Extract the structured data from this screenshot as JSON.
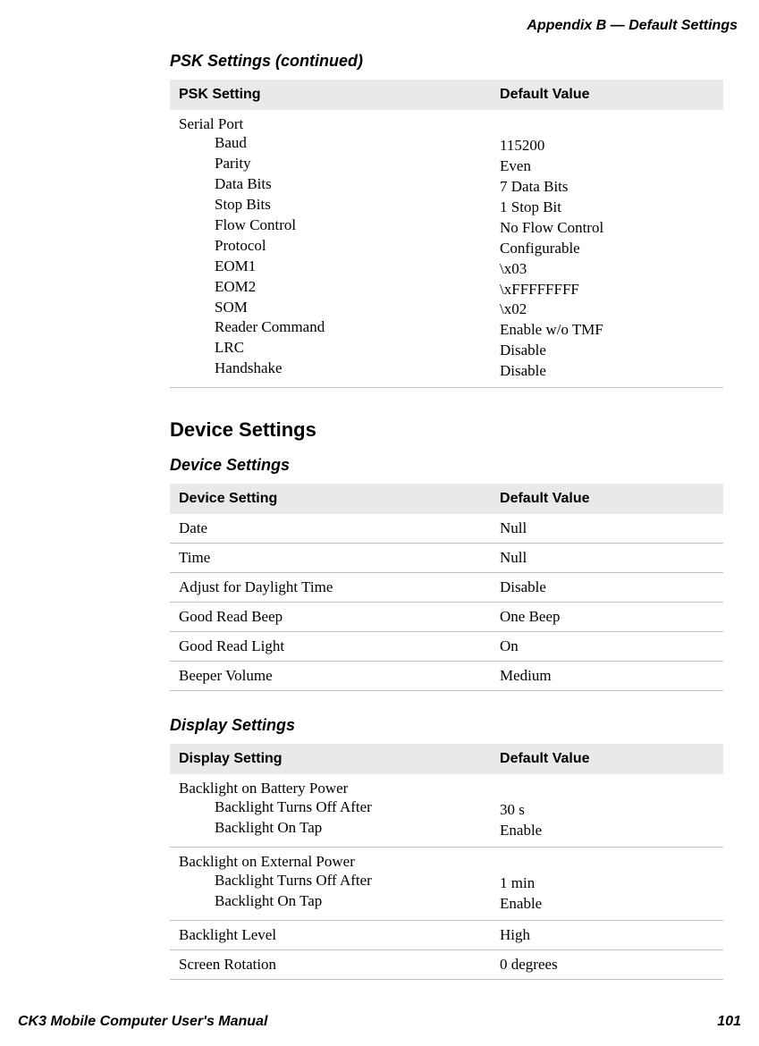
{
  "running_head": "Appendix B — Default Settings",
  "footer": {
    "manual": "CK3 Mobile Computer User's Manual",
    "page": "101"
  },
  "psk": {
    "caption": "PSK Settings (continued)",
    "header_setting": "PSK Setting",
    "header_value": "Default Value",
    "group": "Serial Port",
    "items": [
      {
        "name": "Baud",
        "value": "115200"
      },
      {
        "name": "Parity",
        "value": "Even"
      },
      {
        "name": "Data Bits",
        "value": "7 Data Bits"
      },
      {
        "name": "Stop Bits",
        "value": "1 Stop Bit"
      },
      {
        "name": "Flow Control",
        "value": "No Flow Control"
      },
      {
        "name": "Protocol",
        "value": "Configurable"
      },
      {
        "name": "EOM1",
        "value": "\\x03"
      },
      {
        "name": "EOM2",
        "value": "\\xFFFFFFFF"
      },
      {
        "name": "SOM",
        "value": "\\x02"
      },
      {
        "name": "Reader Command",
        "value": "Enable w/o TMF"
      },
      {
        "name": "LRC",
        "value": "Disable"
      },
      {
        "name": "Handshake",
        "value": "Disable"
      }
    ]
  },
  "device": {
    "section_heading": "Device Settings",
    "caption": "Device Settings",
    "header_setting": "Device Setting",
    "header_value": "Default Value",
    "rows": [
      {
        "name": "Date",
        "value": "Null"
      },
      {
        "name": "Time",
        "value": "Null"
      },
      {
        "name": "Adjust for Daylight Time",
        "value": "Disable"
      },
      {
        "name": "Good Read Beep",
        "value": "One Beep"
      },
      {
        "name": "Good Read Light",
        "value": "On"
      },
      {
        "name": "Beeper Volume",
        "value": "Medium"
      }
    ]
  },
  "display": {
    "caption": "Display Settings",
    "header_setting": "Display Setting",
    "header_value": "Default Value",
    "group1": {
      "parent": "Backlight on Battery Power",
      "items": [
        {
          "name": "Backlight Turns Off After",
          "value": "30 s"
        },
        {
          "name": "Backlight On Tap",
          "value": "Enable"
        }
      ]
    },
    "group2": {
      "parent": "Backlight on External Power",
      "items": [
        {
          "name": "Backlight Turns Off After",
          "value": "1 min"
        },
        {
          "name": "Backlight On Tap",
          "value": "Enable"
        }
      ]
    },
    "rows": [
      {
        "name": "Backlight Level",
        "value": "High"
      },
      {
        "name": "Screen Rotation",
        "value": "0 degrees"
      }
    ]
  }
}
